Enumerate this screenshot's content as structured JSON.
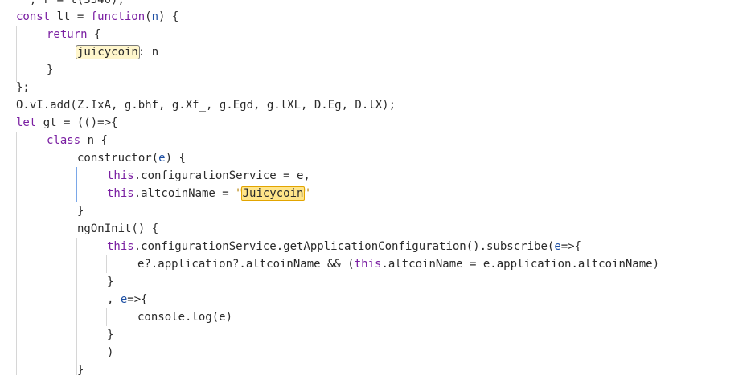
{
  "editor": {
    "search_term": "juicycoin",
    "lines": [
      {
        "tokens": [
          {
            "t": "  , ",
            "c": "pl"
          },
          {
            "t": "r",
            "c": "pl"
          },
          {
            "t": " = ",
            "c": "pl"
          },
          {
            "t": "t(3540);",
            "c": "pl"
          }
        ]
      },
      {
        "tokens": [
          {
            "t": "const",
            "c": "kw"
          },
          {
            "t": " lt = ",
            "c": "pl"
          },
          {
            "t": "function",
            "c": "fn"
          },
          {
            "t": "(",
            "c": "pl"
          },
          {
            "t": "n",
            "c": "param"
          },
          {
            "t": ") {",
            "c": "pl"
          }
        ]
      },
      {
        "tokens": [
          {
            "t": "return",
            "c": "kw"
          },
          {
            "t": " {",
            "c": "pl"
          }
        ]
      },
      {
        "tokens": [
          {
            "t": "juicycoin",
            "c": "pl",
            "hl": "search-hit"
          },
          {
            "t": ": n",
            "c": "pl"
          }
        ]
      },
      {
        "tokens": [
          {
            "t": "}",
            "c": "pl"
          }
        ]
      },
      {
        "tokens": [
          {
            "t": "};",
            "c": "pl"
          }
        ]
      },
      {
        "tokens": [
          {
            "t": "O.vI.add(Z.IxA, g.bhf, g.Xf_, g.Egd, g.lXL, D.Eg, D.lX);",
            "c": "pl"
          }
        ]
      },
      {
        "tokens": [
          {
            "t": "let",
            "c": "kw"
          },
          {
            "t": " gt = (()=>{",
            "c": "pl"
          }
        ]
      },
      {
        "tokens": [
          {
            "t": "class",
            "c": "kw"
          },
          {
            "t": " n {",
            "c": "pl"
          }
        ]
      },
      {
        "tokens": [
          {
            "t": "constructor(",
            "c": "pl"
          },
          {
            "t": "e",
            "c": "param"
          },
          {
            "t": ") {",
            "c": "pl"
          }
        ]
      },
      {
        "tokens": [
          {
            "t": "this",
            "c": "kw"
          },
          {
            "t": ".configurationService = e,",
            "c": "pl"
          }
        ]
      },
      {
        "tokens": [
          {
            "t": "this",
            "c": "kw"
          },
          {
            "t": ".altcoinName = ",
            "c": "pl"
          },
          {
            "t": "\"",
            "c": "str"
          },
          {
            "t": "Juicycoin",
            "c": "pl",
            "hl": "search-hit-active"
          },
          {
            "t": "\"",
            "c": "str"
          }
        ]
      },
      {
        "tokens": [
          {
            "t": "}",
            "c": "pl"
          }
        ]
      },
      {
        "tokens": [
          {
            "t": "ngOnInit() {",
            "c": "pl"
          }
        ]
      },
      {
        "tokens": [
          {
            "t": "this",
            "c": "kw"
          },
          {
            "t": ".configurationService.getApplicationConfiguration().subscribe(",
            "c": "pl"
          },
          {
            "t": "e",
            "c": "param"
          },
          {
            "t": "=>{",
            "c": "pl"
          }
        ]
      },
      {
        "tokens": [
          {
            "t": "e?.application?.altcoinName && (",
            "c": "pl"
          },
          {
            "t": "this",
            "c": "kw"
          },
          {
            "t": ".altcoinName = e.application.altcoinName)",
            "c": "pl"
          }
        ]
      },
      {
        "tokens": [
          {
            "t": "}",
            "c": "pl"
          }
        ]
      },
      {
        "tokens": [
          {
            "t": ", ",
            "c": "pl"
          },
          {
            "t": "e",
            "c": "param"
          },
          {
            "t": "=>{",
            "c": "pl"
          }
        ]
      },
      {
        "tokens": [
          {
            "t": "console.log(e)",
            "c": "pl"
          }
        ]
      },
      {
        "tokens": [
          {
            "t": "}",
            "c": "pl"
          }
        ]
      },
      {
        "tokens": [
          {
            "t": ")",
            "c": "pl"
          }
        ]
      },
      {
        "tokens": [
          {
            "t": "}",
            "c": "pl"
          }
        ]
      }
    ]
  }
}
